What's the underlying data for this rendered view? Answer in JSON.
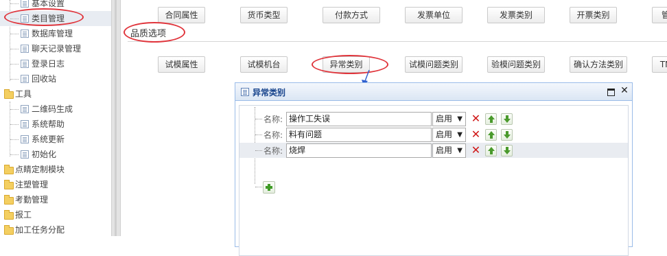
{
  "sidebar": {
    "items": [
      {
        "label": "基本设置",
        "type": "page",
        "indent": 1
      },
      {
        "label": "类目管理",
        "type": "page",
        "indent": 1,
        "active": true
      },
      {
        "label": "数据库管理",
        "type": "page",
        "indent": 1
      },
      {
        "label": "聊天记录管理",
        "type": "page",
        "indent": 1
      },
      {
        "label": "登录日志",
        "type": "page",
        "indent": 1
      },
      {
        "label": "回收站",
        "type": "page",
        "indent": 1
      },
      {
        "label": "工具",
        "type": "folder",
        "indent": 0
      },
      {
        "label": "二维码生成",
        "type": "page",
        "indent": 1
      },
      {
        "label": "系统帮助",
        "type": "page",
        "indent": 1
      },
      {
        "label": "系统更新",
        "type": "page",
        "indent": 1
      },
      {
        "label": "初始化",
        "type": "page",
        "indent": 1
      },
      {
        "label": "点睛定制模块",
        "type": "folder",
        "indent": 0
      },
      {
        "label": "注塑管理",
        "type": "folder",
        "indent": 0
      },
      {
        "label": "考勤管理",
        "type": "folder",
        "indent": 0
      },
      {
        "label": "报工",
        "type": "folder",
        "indent": 0
      },
      {
        "label": "加工任务分配",
        "type": "folder",
        "indent": 0
      }
    ]
  },
  "top_options": [
    "合同属性",
    "货币类型",
    "付款方式",
    "发票单位",
    "发票类别",
    "开票类别",
    "管"
  ],
  "quality_section": {
    "title": "品质选项",
    "options": [
      "试模属性",
      "试模机台",
      "异常类别",
      "试模问题类别",
      "验模问题类别",
      "确认方法类别",
      "TN"
    ]
  },
  "dialog": {
    "title": "异常类别",
    "name_label": "名称:",
    "items": [
      {
        "name": "操作工失误",
        "status": "启用"
      },
      {
        "name": "料有问题",
        "status": "启用"
      },
      {
        "name": "烧焊",
        "status": "启用"
      }
    ],
    "close_glyph": "✕",
    "delete_glyph": "✕",
    "select_arrow": "▼"
  },
  "colors": {
    "annotation_red": "#e0343b",
    "dialog_border": "#99bbe8",
    "dialog_title": "#15428b",
    "pointer_blue": "#3060d0"
  }
}
